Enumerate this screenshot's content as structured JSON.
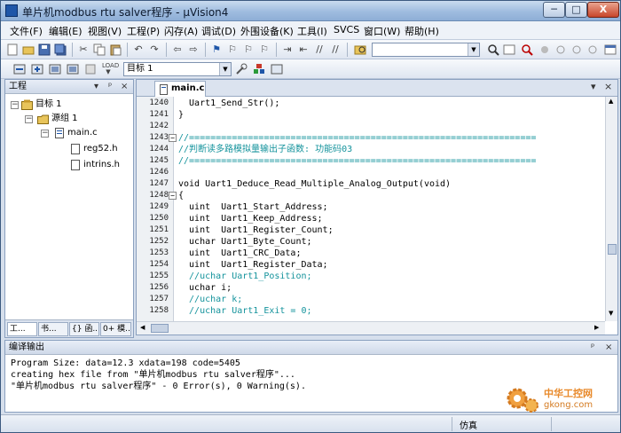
{
  "window": {
    "title": "单片机modbus rtu salver程序 - µVision4",
    "controls": {
      "minimize": "─",
      "maximize": "□",
      "close": "X"
    }
  },
  "menu": [
    "文件(F)",
    "编辑(E)",
    "视图(V)",
    "工程(P)",
    "闪存(A)",
    "调试(D)",
    "外围设备(K)",
    "工具(I)",
    "SVCS",
    "窗口(W)",
    "帮助(H)"
  ],
  "toolbar2": {
    "target_select": "目标 1"
  },
  "project_pane": {
    "title": "工程",
    "controls": {
      "pin": "▾",
      "autohide": "ᵖ",
      "close": "×"
    },
    "tree": {
      "target": "目标 1",
      "group": "源组 1",
      "file": "main.c",
      "includes": [
        "reg52.h",
        "intrins.h"
      ]
    },
    "tabs": [
      "工...",
      "书...",
      "{} 函...",
      "0+ 模..."
    ]
  },
  "editor": {
    "tab": "main.c",
    "controls": {
      "dropdown": "▾",
      "close": "×"
    },
    "lines": [
      {
        "num": "1240",
        "text": "  Uart1_Send_Str();",
        "comment": false,
        "fold": ""
      },
      {
        "num": "1241",
        "text": "}",
        "comment": false,
        "fold": ""
      },
      {
        "num": "1242",
        "text": "",
        "comment": false,
        "fold": ""
      },
      {
        "num": "1243",
        "text": "//=================================================================",
        "comment": true,
        "fold": "−"
      },
      {
        "num": "1244",
        "text": "//判断读多路模拟量输出子函数: 功能码03",
        "comment": true,
        "fold": ""
      },
      {
        "num": "1245",
        "text": "//=================================================================",
        "comment": true,
        "fold": ""
      },
      {
        "num": "1246",
        "text": "",
        "comment": false,
        "fold": ""
      },
      {
        "num": "1247",
        "text": "void Uart1_Deduce_Read_Multiple_Analog_Output(void)",
        "comment": false,
        "fold": ""
      },
      {
        "num": "1248",
        "text": "{",
        "comment": false,
        "fold": "−"
      },
      {
        "num": "1249",
        "text": "  uint  Uart1_Start_Address;",
        "comment": false,
        "fold": ""
      },
      {
        "num": "1250",
        "text": "  uint  Uart1_Keep_Address;",
        "comment": false,
        "fold": ""
      },
      {
        "num": "1251",
        "text": "  uint  Uart1_Register_Count;",
        "comment": false,
        "fold": ""
      },
      {
        "num": "1252",
        "text": "  uchar Uart1_Byte_Count;",
        "comment": false,
        "fold": ""
      },
      {
        "num": "1253",
        "text": "  uint  Uart1_CRC_Data;",
        "comment": false,
        "fold": ""
      },
      {
        "num": "1254",
        "text": "  uint  Uart1_Register_Data;",
        "comment": false,
        "fold": ""
      },
      {
        "num": "1255",
        "text": "  //uchar Uart1_Position;",
        "comment": true,
        "fold": ""
      },
      {
        "num": "1256",
        "text": "  uchar i;",
        "comment": false,
        "fold": ""
      },
      {
        "num": "1257",
        "text": "  //uchar k;",
        "comment": true,
        "fold": ""
      },
      {
        "num": "1258",
        "text": "  //uchar Uart1_Exit = 0;",
        "comment": true,
        "fold": ""
      }
    ]
  },
  "build_output": {
    "title": "编译输出",
    "controls": {
      "pin": "ᵖ",
      "close": "×"
    },
    "lines": [
      "Program Size: data=12.3 xdata=198 code=5405",
      "creating hex file from \"单片机modbus rtu salver程序\"...",
      "\"单片机modbus rtu salver程序\" - 0 Error(s), 0 Warning(s)."
    ]
  },
  "status": {
    "mode": "仿真"
  },
  "watermark": {
    "name": "中华工控网",
    "url": "gkong.com"
  },
  "colors": {
    "comment": "#14939c",
    "watermark": "#e8892a"
  }
}
